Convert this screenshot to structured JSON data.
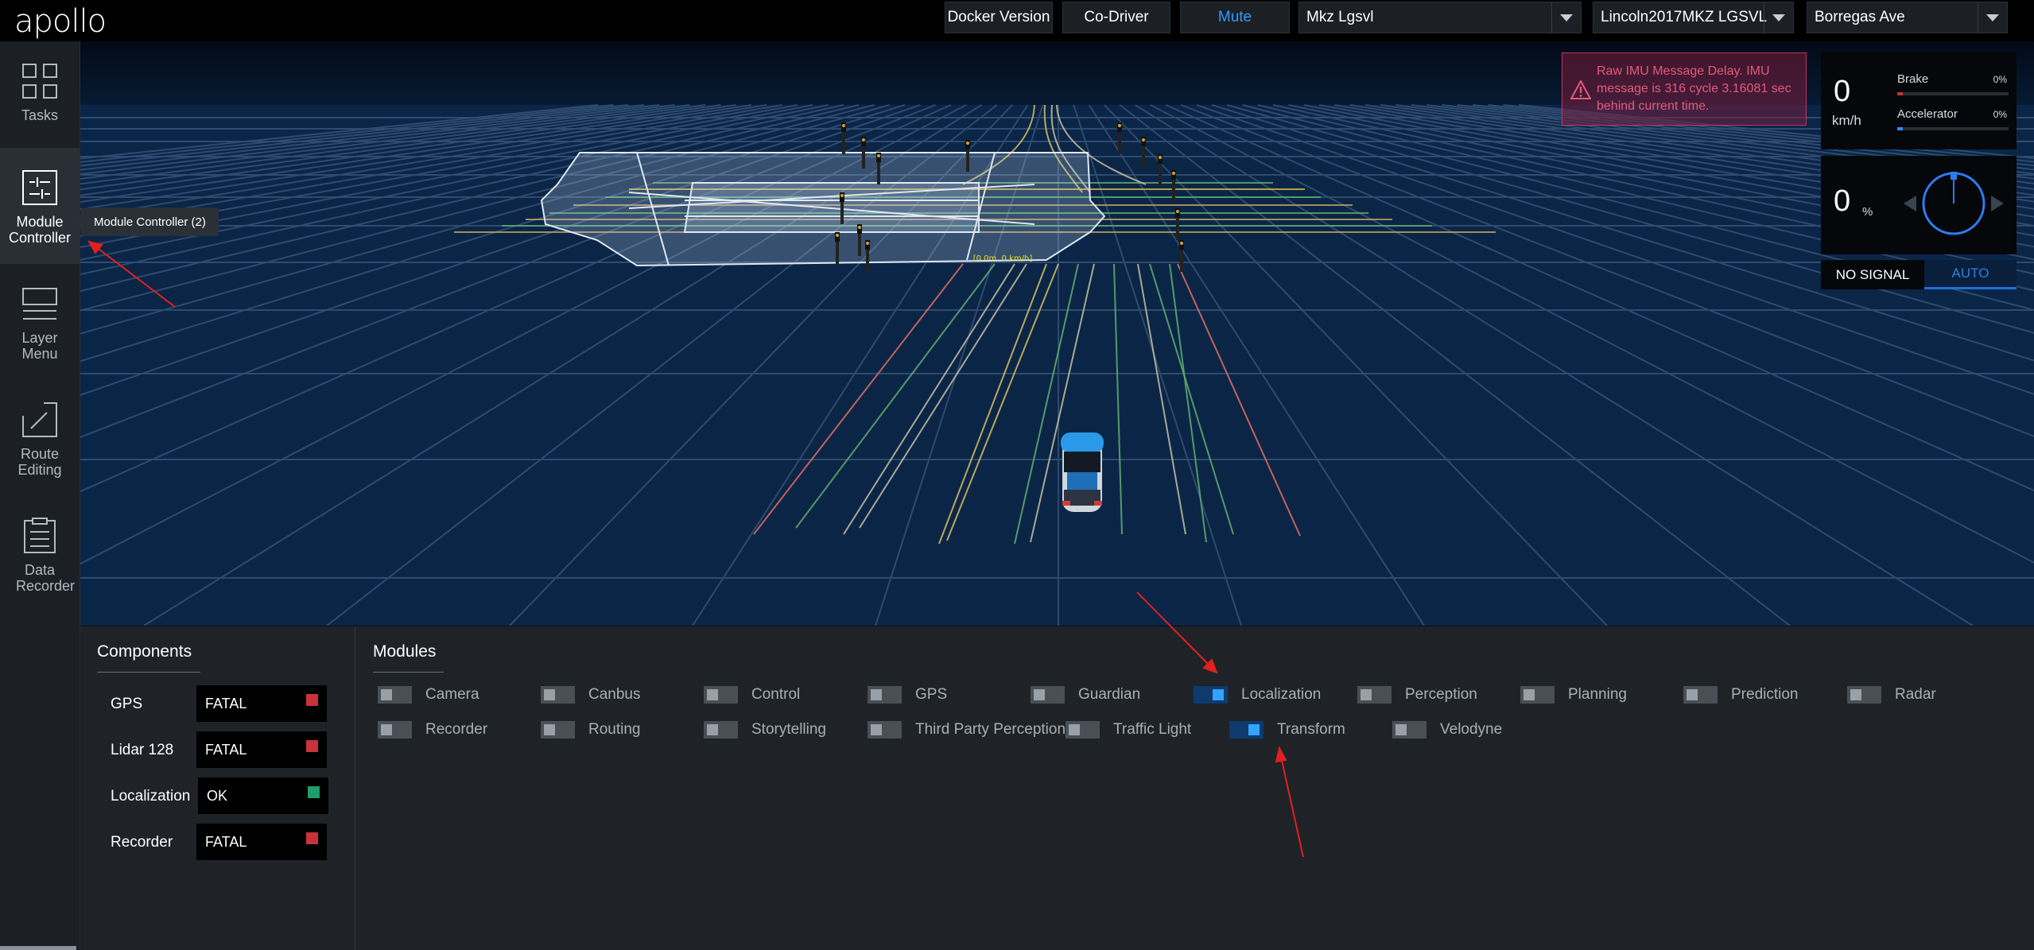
{
  "app": {
    "logo": "apollo"
  },
  "topbar": {
    "docker_version": "Docker Version",
    "co_driver": "Co-Driver",
    "mute": "Mute",
    "mode_select": "Mkz Lgsvl",
    "vehicle_select": "Lincoln2017MKZ LGSVL",
    "map_select": "Borregas Ave"
  },
  "sidebar": {
    "items": [
      {
        "label": "Tasks",
        "icon": "grid-icon"
      },
      {
        "label": "Module Controller",
        "icon": "sliders-icon",
        "active": true
      },
      {
        "label": "Layer Menu",
        "icon": "layers-icon"
      },
      {
        "label": "Route Editing",
        "icon": "route-edit-icon"
      },
      {
        "label": "Data Recorder",
        "icon": "clipboard-icon"
      }
    ],
    "tooltip": "Module Controller (2)"
  },
  "alert": {
    "message": "Raw IMU Message Delay. IMU message is 316 cycle 3.16081 sec behind current time.",
    "icon": "warning-icon",
    "color": "#e25a7c"
  },
  "dashboard": {
    "speed": "0",
    "speed_unit": "km/h",
    "brake_label": "Brake",
    "brake_pct": "0%",
    "accelerator_label": "Accelerator",
    "accelerator_pct": "0%",
    "steering": "0",
    "steering_unit": "%",
    "signal": "NO SIGNAL",
    "drive_mode": "AUTO"
  },
  "scene": {
    "lane_label": "[0.0m, 0 km/h]"
  },
  "components": {
    "title": "Components",
    "items": [
      {
        "name": "GPS",
        "status": "FATAL",
        "color": "#c8333a"
      },
      {
        "name": "Lidar 128",
        "status": "FATAL",
        "color": "#c8333a"
      },
      {
        "name": "Localization",
        "status": "OK",
        "color": "#1e9e6a"
      },
      {
        "name": "Recorder",
        "status": "FATAL",
        "color": "#c8333a"
      }
    ]
  },
  "modules": {
    "title": "Modules",
    "row1": [
      {
        "label": "Camera",
        "on": false
      },
      {
        "label": "Canbus",
        "on": false
      },
      {
        "label": "Control",
        "on": false
      },
      {
        "label": "GPS",
        "on": false
      },
      {
        "label": "Guardian",
        "on": false
      },
      {
        "label": "Localization",
        "on": true
      },
      {
        "label": "Perception",
        "on": false
      },
      {
        "label": "Planning",
        "on": false
      },
      {
        "label": "Prediction",
        "on": false
      },
      {
        "label": "Radar",
        "on": false
      }
    ],
    "row2": [
      {
        "label": "Recorder",
        "on": false
      },
      {
        "label": "Routing",
        "on": false
      },
      {
        "label": "Storytelling",
        "on": false
      },
      {
        "label": "Third Party Perception",
        "on": false
      },
      {
        "label": "Traffic Light",
        "on": false
      },
      {
        "label": "Transform",
        "on": true
      },
      {
        "label": "Velodyne",
        "on": false
      }
    ]
  }
}
